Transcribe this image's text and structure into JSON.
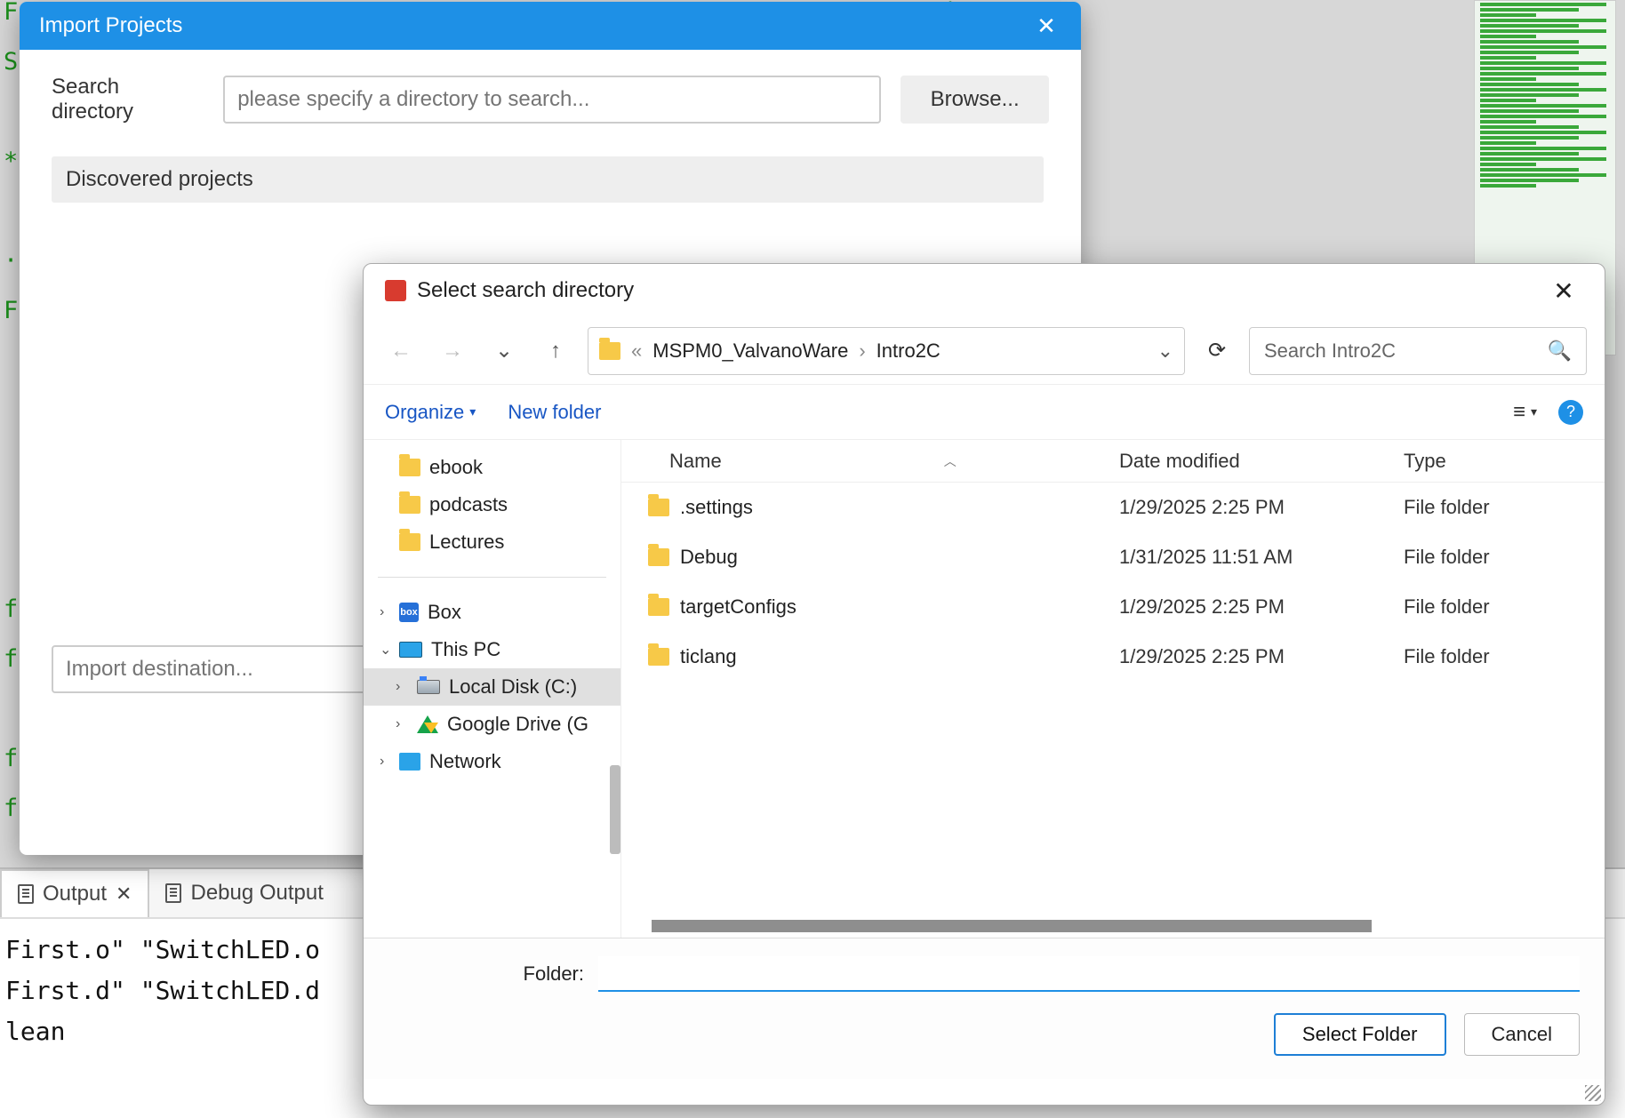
{
  "background": {
    "code_lines": "F                                                              ation\nS\n\n*\n\n·\nF\n\n\n\n\n\nfi\nfi\n  \nfi\nfi",
    "output_tab": "Output",
    "debug_tab": "Debug Output",
    "output_text": "First.o\" \"SwitchLED.o\nFirst.d\" \"SwitchLED.d\nlean"
  },
  "import_dialog": {
    "title": "Import Projects",
    "search_label": "Search directory",
    "search_placeholder": "please specify a directory to search...",
    "browse": "Browse...",
    "discovered_label": "Discovered projects",
    "dest_placeholder": "Import destination..."
  },
  "picker": {
    "title": "Select search directory",
    "breadcrumb": {
      "sep": "«",
      "seg1": "MSPM0_ValvanoWare",
      "seg2": "Intro2C"
    },
    "search_placeholder": "Search Intro2C",
    "organize": "Organize",
    "new_folder": "New folder",
    "tree": {
      "ebook": "ebook",
      "podcasts": "podcasts",
      "lectures": "Lectures",
      "box": "Box",
      "this_pc": "This PC",
      "local_disk": "Local Disk (C:)",
      "gdrive": "Google Drive (G",
      "network": "Network"
    },
    "columns": {
      "name": "Name",
      "date": "Date modified",
      "type": "Type"
    },
    "rows": [
      {
        "name": ".settings",
        "date": "1/29/2025 2:25 PM",
        "type": "File folder"
      },
      {
        "name": "Debug",
        "date": "1/31/2025 11:51 AM",
        "type": "File folder"
      },
      {
        "name": "targetConfigs",
        "date": "1/29/2025 2:25 PM",
        "type": "File folder"
      },
      {
        "name": "ticlang",
        "date": "1/29/2025 2:25 PM",
        "type": "File folder"
      }
    ],
    "folder_label": "Folder:",
    "folder_value": "",
    "select_btn": "Select Folder",
    "cancel_btn": "Cancel"
  }
}
